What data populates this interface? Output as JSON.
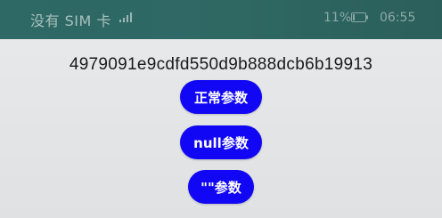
{
  "status_bar": {
    "carrier": "没有 SIM 卡",
    "signal_icon": "no-signal-icon",
    "battery_percent": "11%",
    "battery_icon": "battery-icon",
    "time": "06:55",
    "background_color": "#2e6965"
  },
  "main": {
    "hash_text": "4979091e9cdfd550d9b888dcb6b19913",
    "buttons": [
      {
        "label": "正常参数"
      },
      {
        "label": "null参数"
      },
      {
        "label": "\"\"参数"
      }
    ],
    "button_color": "#1107f4"
  }
}
